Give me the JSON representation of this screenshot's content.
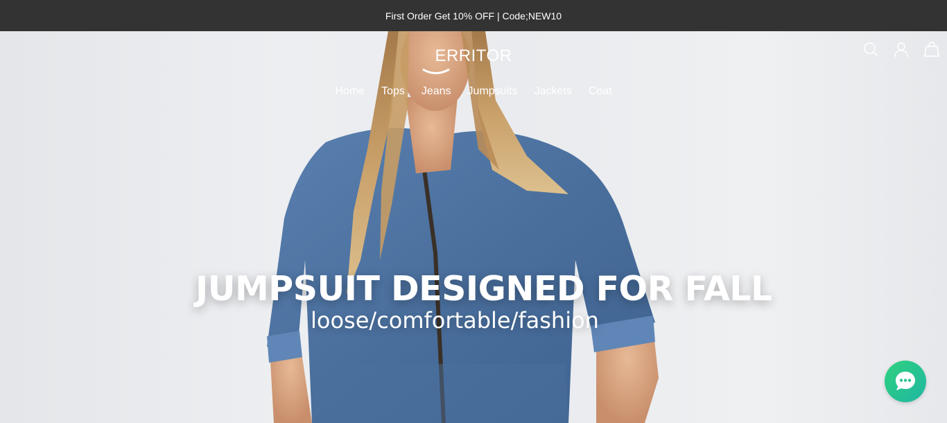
{
  "announcement": {
    "text": "First Order Get 10% OFF | Code;NEW10"
  },
  "header": {
    "logo": "ERRITOR",
    "nav": [
      {
        "label": "Home"
      },
      {
        "label": "Tops"
      },
      {
        "label": "Jeans"
      },
      {
        "label": "Jumpsuits"
      },
      {
        "label": "Jackets"
      },
      {
        "label": "Coat"
      }
    ],
    "icons": [
      "search-icon",
      "account-icon",
      "cart-icon"
    ]
  },
  "hero": {
    "headline": "JUMPSUIT DESIGNED FOR FALL",
    "subheadline": "loose/comfortable/fashion"
  },
  "chat": {
    "icon": "chat-bubble-icon"
  },
  "colors": {
    "announcement_bg": "#333333",
    "text_on_dark": "#ffffff",
    "chat_gradient_start": "#2fd07e",
    "chat_gradient_end": "#20b7a2",
    "denim": "#4f75a5"
  }
}
